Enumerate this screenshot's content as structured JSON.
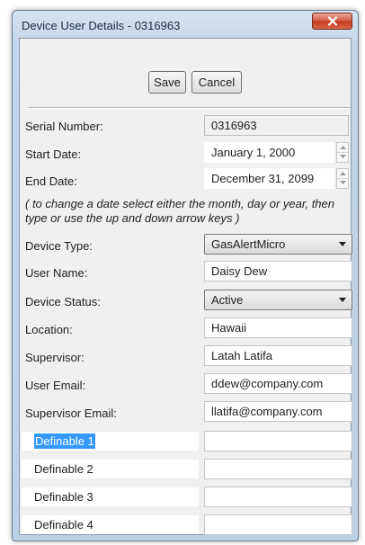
{
  "window": {
    "title": "Device User Details - 0316963"
  },
  "toolbar": {
    "save_label": "Save",
    "cancel_label": "Cancel"
  },
  "fields": {
    "serial_number": {
      "label": "Serial Number:",
      "value": "0316963"
    },
    "start_date": {
      "label": "Start Date:",
      "value": "January 1, 2000"
    },
    "end_date": {
      "label": "End Date:",
      "value": "December 31, 2099"
    },
    "hint": "( to change a date select either the month, day or year, then type or use the up and down arrow keys )",
    "device_type": {
      "label": "Device Type:",
      "value": "GasAlertMicro"
    },
    "user_name": {
      "label": "User Name:",
      "value": "Daisy Dew"
    },
    "device_status": {
      "label": "Device Status:",
      "value": "Active"
    },
    "location": {
      "label": "Location:",
      "value": "Hawaii"
    },
    "supervisor": {
      "label": "Supervisor:",
      "value": "Latah Latifa"
    },
    "user_email": {
      "label": "User Email:",
      "value": "ddew@company.com"
    },
    "supervisor_email": {
      "label": "Supervisor Email:",
      "value": "llatifa@company.com"
    }
  },
  "definables": [
    {
      "label": "Definable 1",
      "value": "",
      "selected": true
    },
    {
      "label": "Definable 2",
      "value": ""
    },
    {
      "label": "Definable 3",
      "value": ""
    },
    {
      "label": "Definable 4",
      "value": ""
    }
  ],
  "icons": {
    "close": "close-x-icon",
    "dropdown": "triangle-down-icon",
    "spin_up": "spin-up-icon",
    "spin_down": "spin-down-icon"
  },
  "colors": {
    "close_button": "#c5391e",
    "selection_highlight": "#3399ff",
    "window_frame": "#c2d5ea"
  }
}
